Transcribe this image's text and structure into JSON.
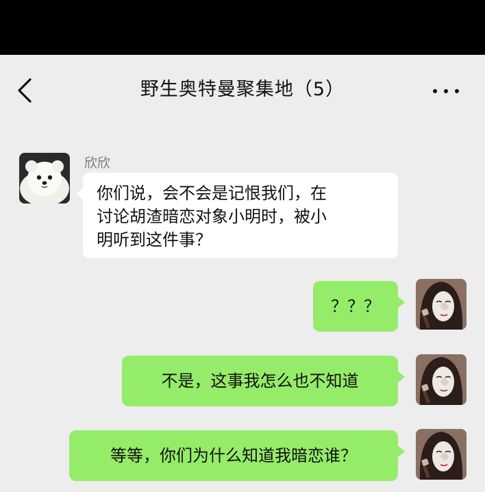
{
  "header": {
    "title": "野生奥特曼聚集地（5）",
    "back_icon": "chevron-left-icon",
    "more_icon": "more-horizontal-icon"
  },
  "messages": [
    {
      "side": "left",
      "sender": "欣欣",
      "avatar": "white-dog-avatar",
      "lines": [
        "你们说，会不会是记恨我们，在",
        "讨论胡渣暗恋对象小明时，被小",
        "明听到这件事？"
      ]
    },
    {
      "side": "right",
      "avatar": "girl-avatar",
      "text": "？？？"
    },
    {
      "side": "right",
      "avatar": "girl-avatar",
      "text": "不是，这事我怎么也不知道"
    },
    {
      "side": "right",
      "avatar": "girl-avatar",
      "text": "等等，你们为什么知道我暗恋谁？"
    }
  ],
  "colors": {
    "chat_background": "#ededed",
    "bubble_received": "#ffffff",
    "bubble_sent": "#95ec69"
  }
}
